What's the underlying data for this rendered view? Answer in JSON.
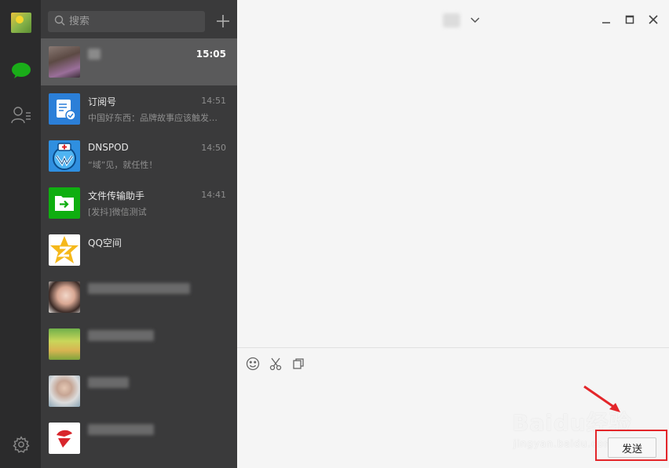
{
  "search": {
    "placeholder": "搜索"
  },
  "chats": [
    {
      "name": "",
      "time": "15:05",
      "preview": "",
      "avatar": "photo-avatar"
    },
    {
      "name": "订阅号",
      "time": "14:51",
      "preview": "中国好东西：品牌故事应该触发…",
      "avatar": "subscription-icon"
    },
    {
      "name": "DNSPOD",
      "time": "14:50",
      "preview": "“域”见，就任性！",
      "avatar": "dnspod-logo"
    },
    {
      "name": "文件传输助手",
      "time": "14:41",
      "preview": "[发抖]微信测试",
      "avatar": "file-transfer-icon"
    },
    {
      "name": "QQ空间",
      "time": "",
      "preview": "",
      "avatar": "qzone-logo"
    },
    {
      "name": "",
      "time": "",
      "preview": "",
      "avatar": "photo-avatar"
    },
    {
      "name": "",
      "time": "",
      "preview": "",
      "avatar": "photo-avatar"
    },
    {
      "name": "",
      "time": "",
      "preview": "",
      "avatar": "photo-avatar"
    },
    {
      "name": "",
      "time": "",
      "preview": "",
      "avatar": "app-logo"
    }
  ],
  "compose": {
    "send_label": "发送"
  },
  "watermark": {
    "main": "Baidu经验",
    "sub": "jingyan.baidu.com"
  },
  "colors": {
    "nav_bg": "#2b2b2c",
    "list_bg": "#3a3a3b",
    "active_item": "#5a5a5b",
    "accent": "#1aad19",
    "highlight": "#e3262a"
  }
}
